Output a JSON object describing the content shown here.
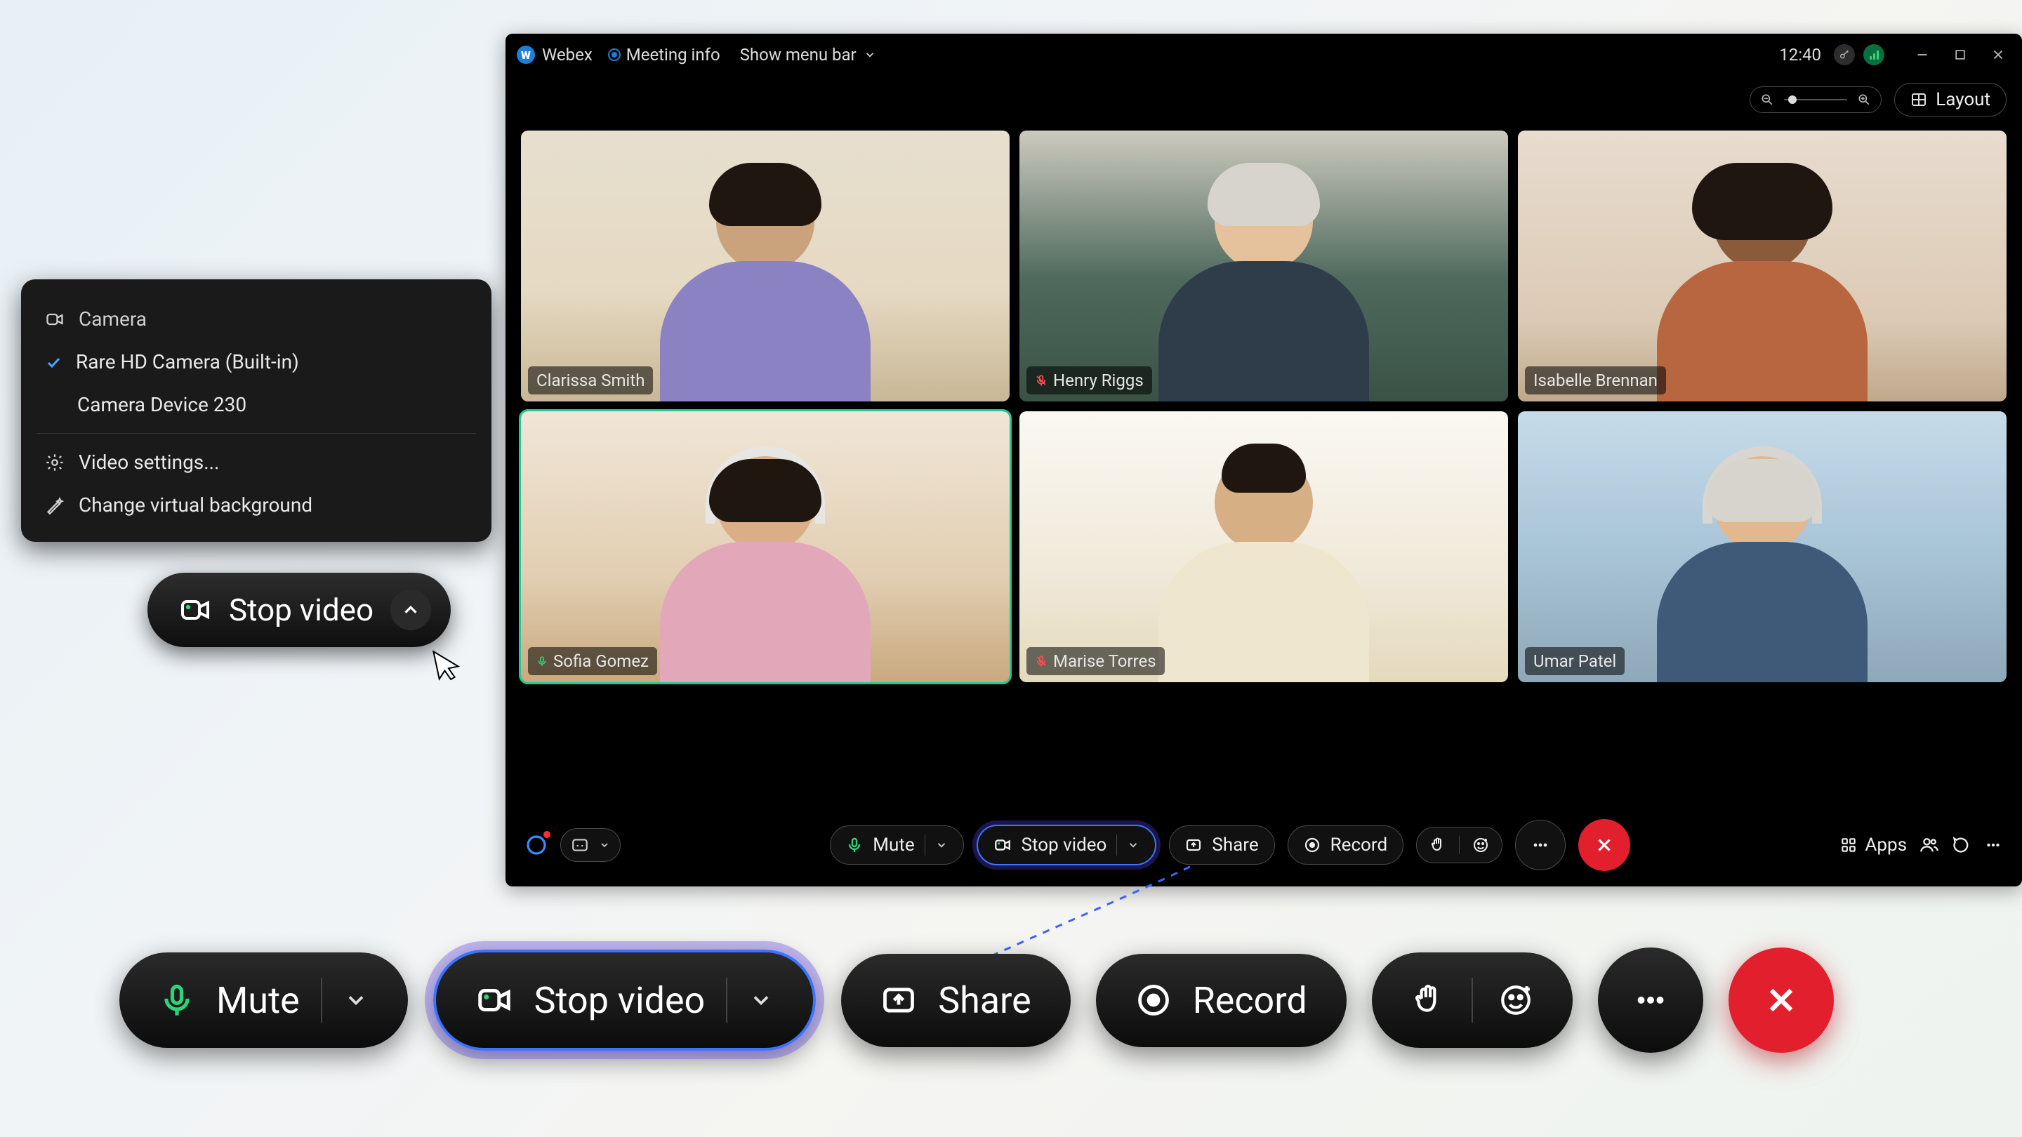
{
  "app": {
    "name": "Webex",
    "meeting_info_label": "Meeting info",
    "show_menu_bar_label": "Show menu bar",
    "clock": "12:40",
    "layout_label": "Layout"
  },
  "participants": [
    {
      "name": "Clarissa Smith",
      "muted": false,
      "speaking": false
    },
    {
      "name": "Henry Riggs",
      "muted": true,
      "speaking": false
    },
    {
      "name": "Isabelle Brennan",
      "muted": false,
      "speaking": false
    },
    {
      "name": "Sofia Gomez",
      "muted": false,
      "speaking": true
    },
    {
      "name": "Marise Torres",
      "muted": true,
      "speaking": false
    },
    {
      "name": "Umar Patel",
      "muted": false,
      "speaking": false
    }
  ],
  "toolbar": {
    "mute_label": "Mute",
    "stop_video_label": "Stop video",
    "share_label": "Share",
    "record_label": "Record",
    "apps_label": "Apps"
  },
  "camera_menu": {
    "header": "Camera",
    "selected_device": "Rare HD Camera (Built-in)",
    "other_device": "Camera Device 230",
    "video_settings_label": "Video settings...",
    "virtual_bg_label": "Change virtual background"
  },
  "callout": {
    "stop_video_label": "Stop video"
  }
}
